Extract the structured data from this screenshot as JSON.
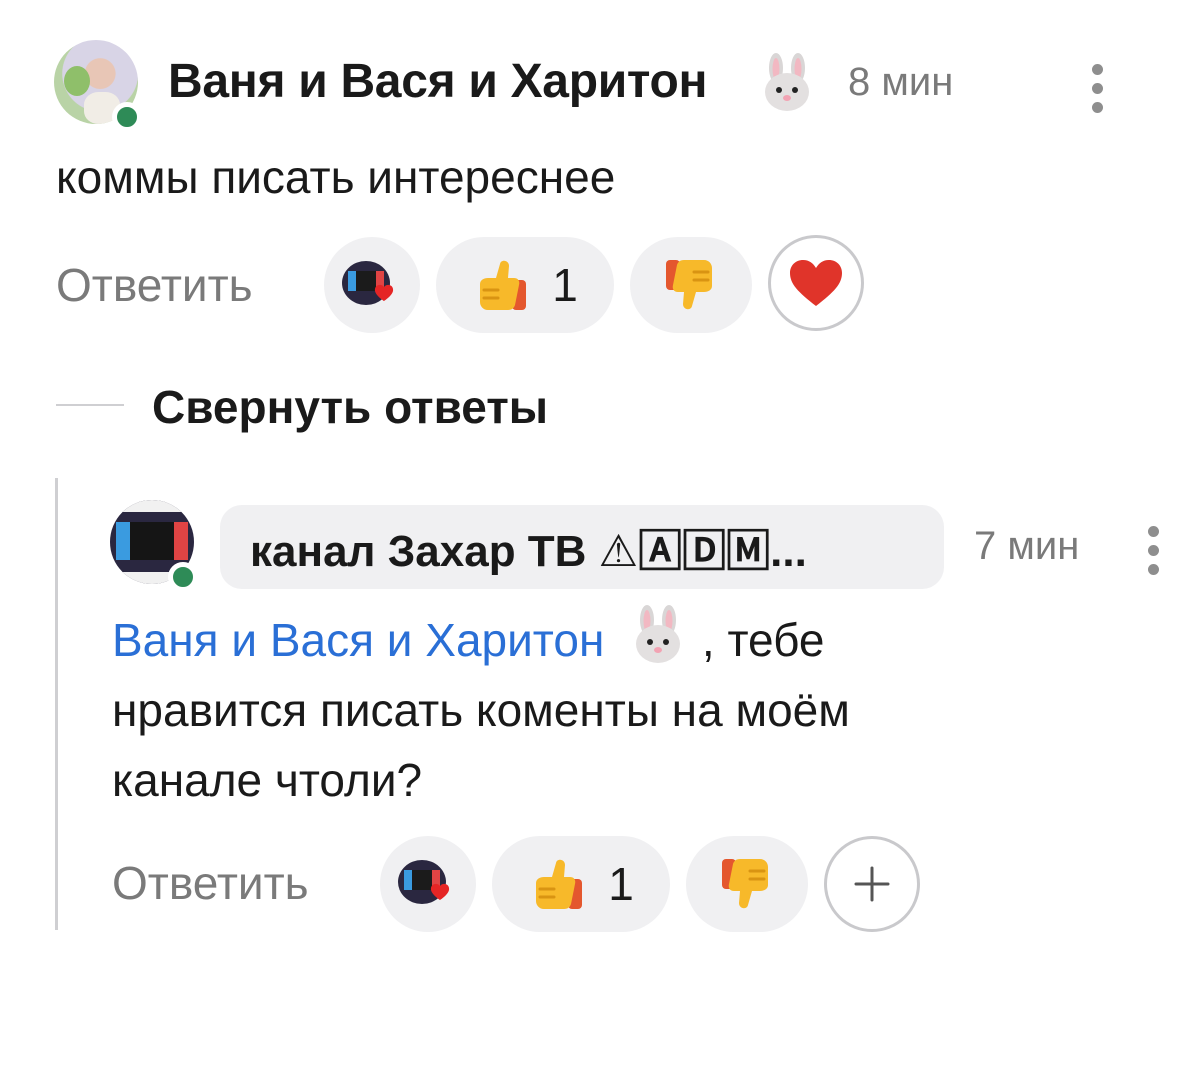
{
  "comment": {
    "author": "Ваня и Вася и Харитон",
    "author_badge_icon": "rabbit-face-icon",
    "time": "8 мин",
    "text": "коммы писать интереснее",
    "reply_label": "Ответить",
    "reactions": {
      "author_heart_icon": "channel-avatar-heart-icon",
      "like_icon": "thumbs-up-icon",
      "like_count": "1",
      "dislike_icon": "thumbs-down-icon",
      "heart_icon": "red-heart-icon"
    }
  },
  "collapse_label": "Свернуть ответы",
  "reply": {
    "author": "канал Захар ТВ ⚠🄰🄳🄼...",
    "time": "7 мин",
    "mention": "Ваня и Вася и Харитон",
    "mention_badge_icon": "rabbit-face-icon",
    "text_line1_suffix": ", тебе",
    "text_line2": "нравится писать коменты на моём",
    "text_line3": "канале чтоли?",
    "reply_label": "Ответить",
    "reactions": {
      "author_heart_icon": "channel-avatar-heart-icon",
      "like_icon": "thumbs-up-icon",
      "like_count": "1",
      "dislike_icon": "thumbs-down-icon",
      "add_icon": "plus-icon"
    }
  },
  "colors": {
    "online": "#2e8b57",
    "mention": "#2a6fd6",
    "pill_bg": "#f0f0f2"
  }
}
